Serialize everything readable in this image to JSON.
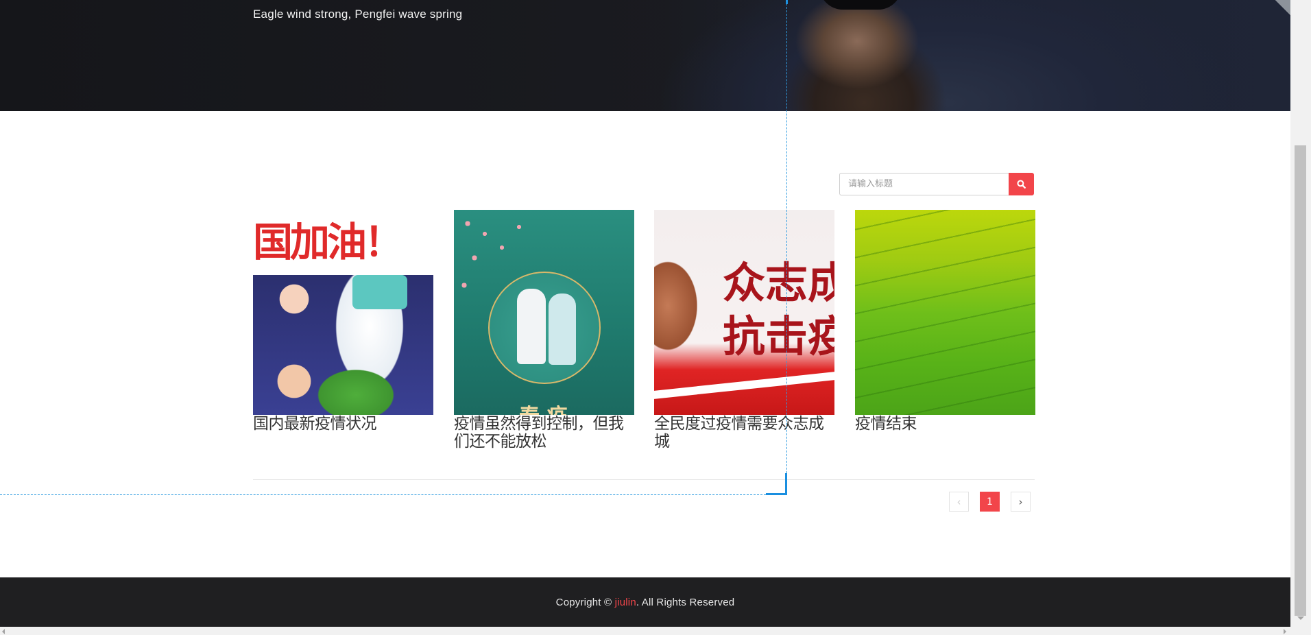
{
  "hero": {
    "tagline": "Eagle wind strong, Pengfei wave spring"
  },
  "search": {
    "placeholder": "请输入标题",
    "button_icon": "search-icon"
  },
  "cards": [
    {
      "title": "国内最新疫情状况",
      "image": "epidemic-illustration",
      "image_text": "国加油！"
    },
    {
      "title": "疫情虽然得到控制，但我们还不能放松",
      "image": "medical-workers-poster",
      "image_text": "春 疫"
    },
    {
      "title": "全民度过疫情需要众志成城",
      "image": "red-slogan-banner",
      "image_text": "众志成\n抗击疫"
    },
    {
      "title": "疫情结束",
      "image": "green-field",
      "image_text": ""
    }
  ],
  "pagination": {
    "prev_label": "‹",
    "current_page": "1",
    "next_label": "›"
  },
  "footer": {
    "prefix": "Copyright © ",
    "link_text": "jiulin",
    "suffix": ". All Rights Reserved"
  },
  "colors": {
    "accent": "#f2454a",
    "footer_bg": "#1f1f21",
    "hero_bg": "#15161a"
  }
}
